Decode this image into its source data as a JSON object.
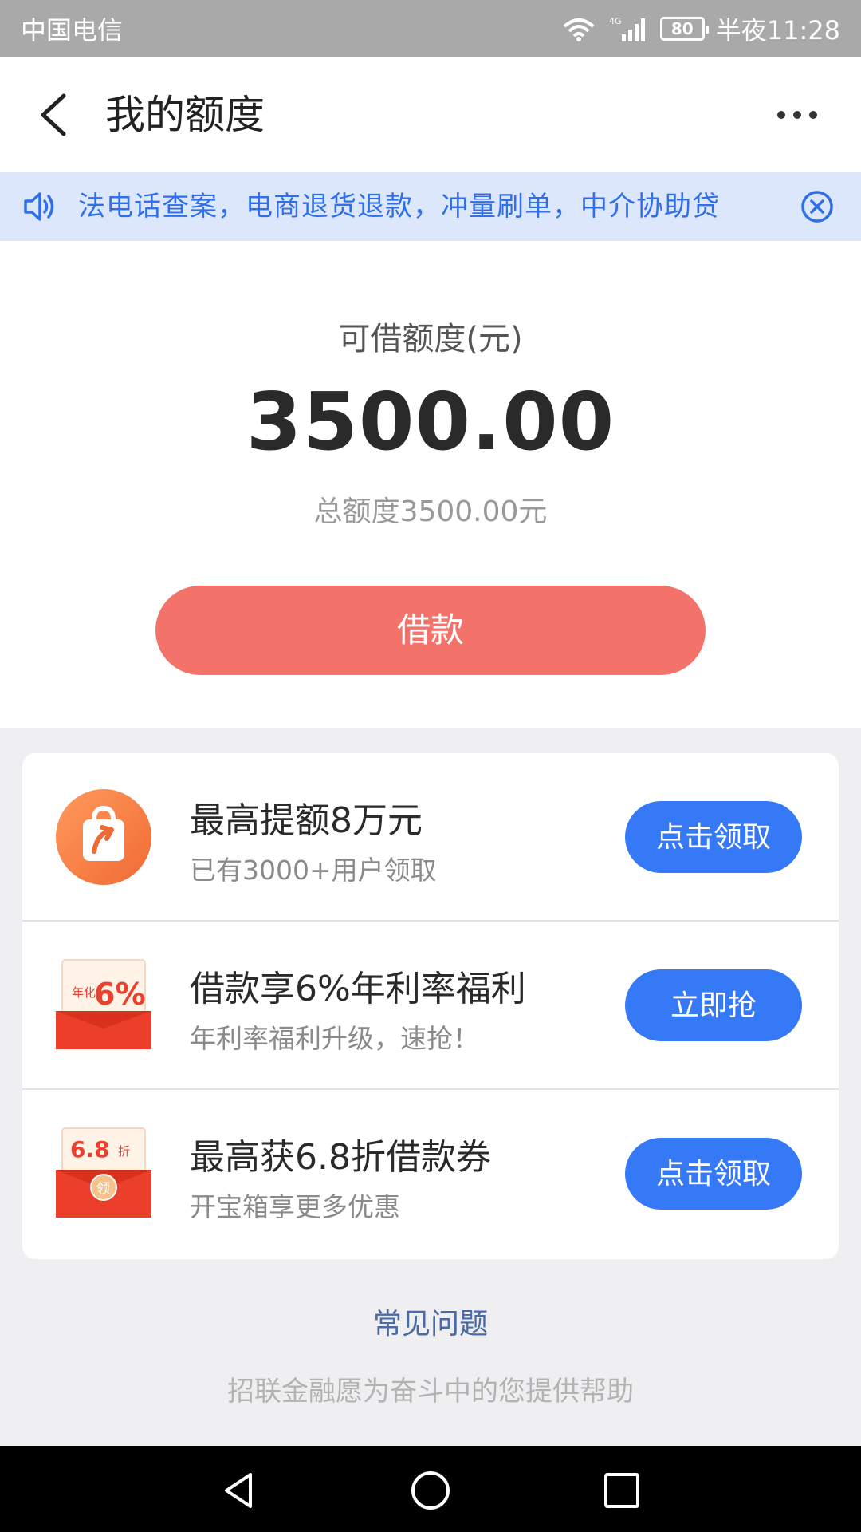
{
  "status_bar": {
    "carrier": "中国电信",
    "network": "4G",
    "battery": "80",
    "time": "半夜11:28"
  },
  "header": {
    "title": "我的额度",
    "back_icon": "back-arrow-icon",
    "more_icon": "more-dots-icon"
  },
  "notice": {
    "text": "法电话查案，电商退货退款，冲量刷单，中介协助贷",
    "speaker_icon": "speaker-icon",
    "close_icon": "close-circle-icon",
    "color": "#2f6fe8"
  },
  "credit": {
    "label": "可借额度(元)",
    "amount": "3500.00",
    "total": "总额度3500.00元",
    "borrow_label": "借款",
    "borrow_color": "#f3736a"
  },
  "offers": [
    {
      "title": "最高提额8万元",
      "subtitle": "已有3000+用户领取",
      "button": "点击领取",
      "icon": "orange-bag-arrow-icon"
    },
    {
      "title": "借款享6%年利率福利",
      "subtitle": "年利率福利升级，速抢！",
      "button": "立即抢",
      "icon": "red-envelope-6pct-icon",
      "icon_text_small": "年化",
      "icon_text_big": "6%"
    },
    {
      "title": "最高获6.8折借款券",
      "subtitle": "开宝箱享更多优惠",
      "button": "点击领取",
      "icon": "red-envelope-coupon-icon",
      "icon_text_big": "6.8",
      "icon_text_small": "折",
      "icon_text_seal": "领"
    }
  ],
  "footer": {
    "faq": "常见问题",
    "slogan": "招联金融愿为奋斗中的您提供帮助"
  },
  "nav": {
    "back": "nav-back-icon",
    "home": "nav-home-icon",
    "recents": "nav-recents-icon"
  },
  "accent_color": "#3579f6"
}
